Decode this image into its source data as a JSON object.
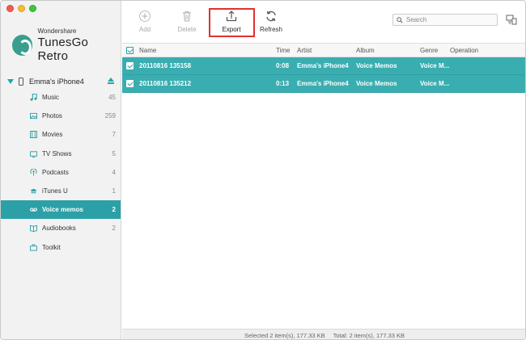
{
  "brand": {
    "small": "Wondershare",
    "big": "TunesGo Retro"
  },
  "device": {
    "name": "Emma's iPhone4"
  },
  "sidebar": {
    "items": [
      {
        "label": "Music",
        "count": "45",
        "icon": "music-icon"
      },
      {
        "label": "Photos",
        "count": "259",
        "icon": "photos-icon"
      },
      {
        "label": "Movies",
        "count": "7",
        "icon": "movies-icon"
      },
      {
        "label": "TV Shows",
        "count": "5",
        "icon": "tv-icon"
      },
      {
        "label": "Podcasts",
        "count": "4",
        "icon": "podcast-icon"
      },
      {
        "label": "iTunes U",
        "count": "1",
        "icon": "itunes-u-icon"
      },
      {
        "label": "Voice memos",
        "count": "2",
        "icon": "voicememo-icon",
        "active": true
      },
      {
        "label": "Audiobooks",
        "count": "2",
        "icon": "audiobook-icon"
      },
      {
        "label": "Toolkit",
        "count": "",
        "icon": "toolkit-icon"
      }
    ]
  },
  "toolbar": {
    "add_label": "Add",
    "delete_label": "Delete",
    "export_label": "Export",
    "refresh_label": "Refresh",
    "search_placeholder": "Search"
  },
  "table": {
    "headers": {
      "name": "Name",
      "time": "Time",
      "artist": "Artist",
      "album": "Album",
      "genre": "Genre",
      "operation": "Operation"
    },
    "rows": [
      {
        "name": "20110816 135158",
        "time": "0:08",
        "artist": "Emma's iPhone4",
        "album": "Voice Memos",
        "genre": "Voice M..."
      },
      {
        "name": "20110816 135212",
        "time": "0:13",
        "artist": "Emma's iPhone4",
        "album": "Voice Memos",
        "genre": "Voice M..."
      }
    ]
  },
  "status": {
    "selected": "Selected 2 item(s), 177.33 KB",
    "total": "Total: 2 item(s), 177.33 KB"
  },
  "colors": {
    "accent": "#2ba0a6",
    "row_selected": "#3aadb0",
    "highlight_box": "#e23030"
  }
}
